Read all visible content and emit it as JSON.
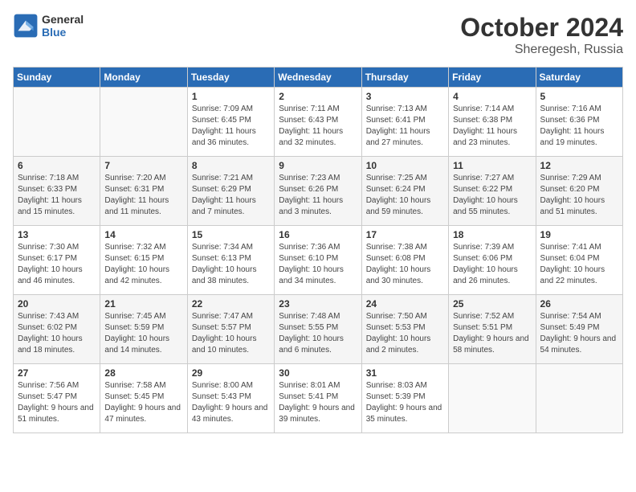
{
  "header": {
    "logo_general": "General",
    "logo_blue": "Blue",
    "month": "October 2024",
    "location": "Sheregesh, Russia"
  },
  "days_of_week": [
    "Sunday",
    "Monday",
    "Tuesday",
    "Wednesday",
    "Thursday",
    "Friday",
    "Saturday"
  ],
  "weeks": [
    [
      {
        "day": "",
        "content": ""
      },
      {
        "day": "",
        "content": ""
      },
      {
        "day": "1",
        "content": "Sunrise: 7:09 AM\nSunset: 6:45 PM\nDaylight: 11 hours and 36 minutes."
      },
      {
        "day": "2",
        "content": "Sunrise: 7:11 AM\nSunset: 6:43 PM\nDaylight: 11 hours and 32 minutes."
      },
      {
        "day": "3",
        "content": "Sunrise: 7:13 AM\nSunset: 6:41 PM\nDaylight: 11 hours and 27 minutes."
      },
      {
        "day": "4",
        "content": "Sunrise: 7:14 AM\nSunset: 6:38 PM\nDaylight: 11 hours and 23 minutes."
      },
      {
        "day": "5",
        "content": "Sunrise: 7:16 AM\nSunset: 6:36 PM\nDaylight: 11 hours and 19 minutes."
      }
    ],
    [
      {
        "day": "6",
        "content": "Sunrise: 7:18 AM\nSunset: 6:33 PM\nDaylight: 11 hours and 15 minutes."
      },
      {
        "day": "7",
        "content": "Sunrise: 7:20 AM\nSunset: 6:31 PM\nDaylight: 11 hours and 11 minutes."
      },
      {
        "day": "8",
        "content": "Sunrise: 7:21 AM\nSunset: 6:29 PM\nDaylight: 11 hours and 7 minutes."
      },
      {
        "day": "9",
        "content": "Sunrise: 7:23 AM\nSunset: 6:26 PM\nDaylight: 11 hours and 3 minutes."
      },
      {
        "day": "10",
        "content": "Sunrise: 7:25 AM\nSunset: 6:24 PM\nDaylight: 10 hours and 59 minutes."
      },
      {
        "day": "11",
        "content": "Sunrise: 7:27 AM\nSunset: 6:22 PM\nDaylight: 10 hours and 55 minutes."
      },
      {
        "day": "12",
        "content": "Sunrise: 7:29 AM\nSunset: 6:20 PM\nDaylight: 10 hours and 51 minutes."
      }
    ],
    [
      {
        "day": "13",
        "content": "Sunrise: 7:30 AM\nSunset: 6:17 PM\nDaylight: 10 hours and 46 minutes."
      },
      {
        "day": "14",
        "content": "Sunrise: 7:32 AM\nSunset: 6:15 PM\nDaylight: 10 hours and 42 minutes."
      },
      {
        "day": "15",
        "content": "Sunrise: 7:34 AM\nSunset: 6:13 PM\nDaylight: 10 hours and 38 minutes."
      },
      {
        "day": "16",
        "content": "Sunrise: 7:36 AM\nSunset: 6:10 PM\nDaylight: 10 hours and 34 minutes."
      },
      {
        "day": "17",
        "content": "Sunrise: 7:38 AM\nSunset: 6:08 PM\nDaylight: 10 hours and 30 minutes."
      },
      {
        "day": "18",
        "content": "Sunrise: 7:39 AM\nSunset: 6:06 PM\nDaylight: 10 hours and 26 minutes."
      },
      {
        "day": "19",
        "content": "Sunrise: 7:41 AM\nSunset: 6:04 PM\nDaylight: 10 hours and 22 minutes."
      }
    ],
    [
      {
        "day": "20",
        "content": "Sunrise: 7:43 AM\nSunset: 6:02 PM\nDaylight: 10 hours and 18 minutes."
      },
      {
        "day": "21",
        "content": "Sunrise: 7:45 AM\nSunset: 5:59 PM\nDaylight: 10 hours and 14 minutes."
      },
      {
        "day": "22",
        "content": "Sunrise: 7:47 AM\nSunset: 5:57 PM\nDaylight: 10 hours and 10 minutes."
      },
      {
        "day": "23",
        "content": "Sunrise: 7:48 AM\nSunset: 5:55 PM\nDaylight: 10 hours and 6 minutes."
      },
      {
        "day": "24",
        "content": "Sunrise: 7:50 AM\nSunset: 5:53 PM\nDaylight: 10 hours and 2 minutes."
      },
      {
        "day": "25",
        "content": "Sunrise: 7:52 AM\nSunset: 5:51 PM\nDaylight: 9 hours and 58 minutes."
      },
      {
        "day": "26",
        "content": "Sunrise: 7:54 AM\nSunset: 5:49 PM\nDaylight: 9 hours and 54 minutes."
      }
    ],
    [
      {
        "day": "27",
        "content": "Sunrise: 7:56 AM\nSunset: 5:47 PM\nDaylight: 9 hours and 51 minutes."
      },
      {
        "day": "28",
        "content": "Sunrise: 7:58 AM\nSunset: 5:45 PM\nDaylight: 9 hours and 47 minutes."
      },
      {
        "day": "29",
        "content": "Sunrise: 8:00 AM\nSunset: 5:43 PM\nDaylight: 9 hours and 43 minutes."
      },
      {
        "day": "30",
        "content": "Sunrise: 8:01 AM\nSunset: 5:41 PM\nDaylight: 9 hours and 39 minutes."
      },
      {
        "day": "31",
        "content": "Sunrise: 8:03 AM\nSunset: 5:39 PM\nDaylight: 9 hours and 35 minutes."
      },
      {
        "day": "",
        "content": ""
      },
      {
        "day": "",
        "content": ""
      }
    ]
  ]
}
